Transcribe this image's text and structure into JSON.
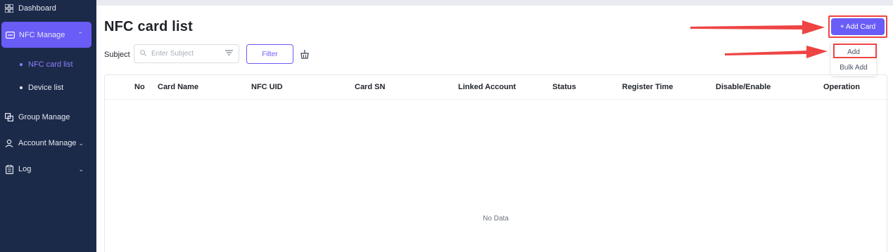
{
  "sidebar": {
    "items": [
      {
        "label": "Dashboard"
      },
      {
        "label": "NFC Manage"
      },
      {
        "label": "NFC card list"
      },
      {
        "label": "Device list"
      },
      {
        "label": "Group Manage"
      },
      {
        "label": "Account Manage"
      },
      {
        "label": "Log"
      }
    ]
  },
  "page": {
    "title": "NFC card list",
    "subject_label": "Subject",
    "search_placeholder": "Enter Subject",
    "filter_label": "Filter",
    "add_card_label": "+ Add Card",
    "dropdown": [
      "Add",
      "Bulk Add"
    ]
  },
  "table": {
    "columns": [
      "No",
      "Card Name",
      "NFC UID",
      "Card SN",
      "Linked Account",
      "Status",
      "Register Time",
      "Disable/Enable",
      "Operation"
    ],
    "empty_text": "No Data"
  },
  "colors": {
    "sidebar_bg": "#1c2a4a",
    "accent": "#6a5cf6",
    "annotation": "#ef4444"
  }
}
